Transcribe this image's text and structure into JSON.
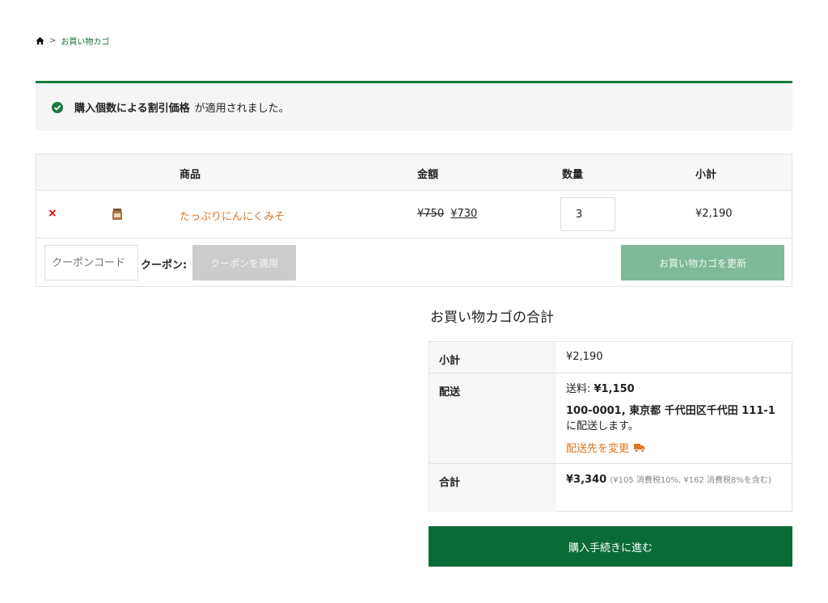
{
  "breadcrumb": {
    "home_icon": "home-icon",
    "separator": ">",
    "current": "お買い物カゴ"
  },
  "notice": {
    "strong": "購入個数による割引価格",
    "text": "が適用されました。",
    "icon": "check-circle-icon",
    "accent": "#1b7a3a"
  },
  "cart": {
    "headers": {
      "product": "商品",
      "price": "金額",
      "quantity": "数量",
      "subtotal": "小計"
    },
    "items": [
      {
        "remove": "×",
        "name": "たっぷりにんにくみそ",
        "old_price": "¥750",
        "new_price": "¥730",
        "quantity": "3",
        "subtotal": "¥2,190"
      }
    ],
    "coupon": {
      "placeholder": "クーポンコード",
      "label": "クーポン:",
      "apply_label": "クーポンを適用"
    },
    "update_label": "お買い物カゴを更新"
  },
  "totals": {
    "title": "お買い物カゴの合計",
    "subtotal_label": "小計",
    "subtotal_value": "¥2,190",
    "shipping_label": "配送",
    "shipping_prefix": "送料: ",
    "shipping_amount": "¥1,150",
    "address": "100-0001, 東京都 千代田区千代田 111-1",
    "address_suffix": " に配送します。",
    "change_address": "配送先を変更",
    "total_label": "合計",
    "total_value": "¥3,340",
    "tax_note": "(¥105 消費税10%, ¥162 消費税8%を含む)"
  },
  "checkout_label": "購入手続きに進む",
  "colors": {
    "brand_green": "#0b6b37",
    "link_orange": "#e0761f",
    "remove_red": "#e00000"
  }
}
